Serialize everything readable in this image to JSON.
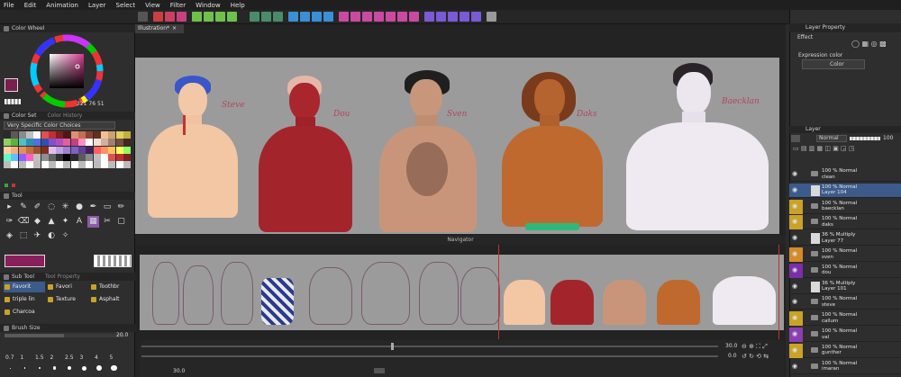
{
  "menu": [
    "File",
    "Edit",
    "Animation",
    "Layer",
    "Select",
    "View",
    "Filter",
    "Window",
    "Help"
  ],
  "left_panel": {
    "color_wheel": {
      "title": "Color Wheel",
      "values": [
        "321",
        "76",
        "51"
      ],
      "current_color": "#7a1f4d"
    },
    "color_set": {
      "title": "Color Set",
      "tab2": "Color History",
      "selection": "Very Specific Color Choices"
    },
    "tool_title": "Tool",
    "sub_tool": {
      "title": "Sub Tool",
      "tab2": "Tool Property",
      "items": [
        "Favorit",
        "Favori",
        "Toothbr",
        "triple lin",
        "Texture",
        "Asphalt",
        "Charcoa"
      ]
    },
    "brush_size": {
      "title": "Brush Size",
      "value": "20.0",
      "presets": [
        "0.7",
        "1",
        "1.5",
        "2",
        "2.5",
        "3",
        "4",
        "5"
      ]
    }
  },
  "canvas": {
    "doc_tab": "Illustration*",
    "signatures": [
      "Steve",
      "Dou",
      "Sven",
      "Daks",
      "Baecklan"
    ]
  },
  "navigator": {
    "title": "Navigator",
    "zoom": "30.0",
    "rotation": "0.0",
    "bottom_zoom": "30.0"
  },
  "right_panel": {
    "layer_property": {
      "title": "Layer Property",
      "effect_label": "Effect",
      "expression_label": "Expression color",
      "expression_value": "Color"
    },
    "layer": {
      "title": "Layer",
      "blend_mode": "Normal",
      "opacity": "100",
      "rows": [
        {
          "line1": "100 % Normal",
          "line2": "clean",
          "type": "folder",
          "tag": "none"
        },
        {
          "line1": "100 % Normal",
          "line2": "Layer 104",
          "type": "thumb",
          "tag": "none",
          "selected": true
        },
        {
          "line1": "100 % Normal",
          "line2": "baecklan",
          "type": "folder",
          "tag": "#c9a227"
        },
        {
          "line1": "100 % Normal",
          "line2": "daks",
          "type": "folder",
          "tag": "#c9a227"
        },
        {
          "line1": "36 % Multiply",
          "line2": "Layer 77",
          "type": "thumb",
          "tag": "none"
        },
        {
          "line1": "100 % Normal",
          "line2": "sven",
          "type": "folder",
          "tag": "#d48b2a"
        },
        {
          "line1": "100 % Normal",
          "line2": "dou",
          "type": "folder",
          "tag": "#7a2fa8"
        },
        {
          "line1": "36 % Multiply",
          "line2": "Layer 101",
          "type": "thumb",
          "tag": "none"
        },
        {
          "line1": "100 % Normal",
          "line2": "steve",
          "type": "folder",
          "tag": "none"
        },
        {
          "line1": "100 % Normal",
          "line2": "callum",
          "type": "folder",
          "tag": "#c9a227"
        },
        {
          "line1": "100 % Normal",
          "line2": "val",
          "type": "folder",
          "tag": "#8a3fb0"
        },
        {
          "line1": "100 % Normal",
          "line2": "gunther",
          "type": "folder",
          "tag": "#c9a227"
        },
        {
          "line1": "100 % Normal",
          "line2": "imaran",
          "type": "folder",
          "tag": "none"
        }
      ]
    }
  }
}
